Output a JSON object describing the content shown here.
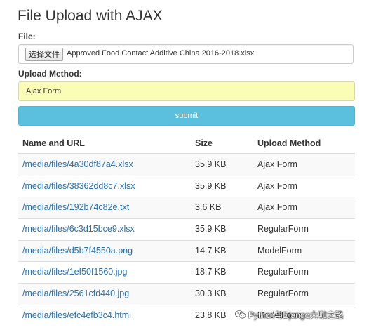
{
  "page": {
    "title": "File Upload with AJAX"
  },
  "form": {
    "file_label": "File:",
    "file_button_label": "选择文件",
    "file_name": "Approved Food Contact Additive China 2016-2018.xlsx",
    "method_label": "Upload Method:",
    "method_value": "Ajax Form",
    "submit_label": "submit"
  },
  "table": {
    "headers": [
      "Name and URL",
      "Size",
      "Upload Method"
    ],
    "rows": [
      {
        "url": "/media/files/4a30df87a4.xlsx",
        "size": "35.9 KB",
        "method": "Ajax Form"
      },
      {
        "url": "/media/files/38362dd8c7.xlsx",
        "size": "35.9 KB",
        "method": "Ajax Form"
      },
      {
        "url": "/media/files/192b74c82e.txt",
        "size": "3.6 KB",
        "method": "Ajax Form"
      },
      {
        "url": "/media/files/6c3d15bce9.xlsx",
        "size": "35.9 KB",
        "method": "RegularForm"
      },
      {
        "url": "/media/files/d5b7f4550a.png",
        "size": "14.7 KB",
        "method": "ModelForm"
      },
      {
        "url": "/media/files/1ef50f1560.jpg",
        "size": "18.7 KB",
        "method": "RegularForm"
      },
      {
        "url": "/media/files/2561cfd440.jpg",
        "size": "30.3 KB",
        "method": "RegularForm"
      },
      {
        "url": "/media/files/efc4efb3c4.html",
        "size": "23.8 KB",
        "method": "ModelForm"
      }
    ]
  },
  "watermark": {
    "text": "Python与Django大咖之路",
    "icon": "wechat-icon"
  },
  "colors": {
    "link": "#2a6fab",
    "submit_bg": "#5bc0de",
    "input_highlight": "#fafdb5"
  }
}
